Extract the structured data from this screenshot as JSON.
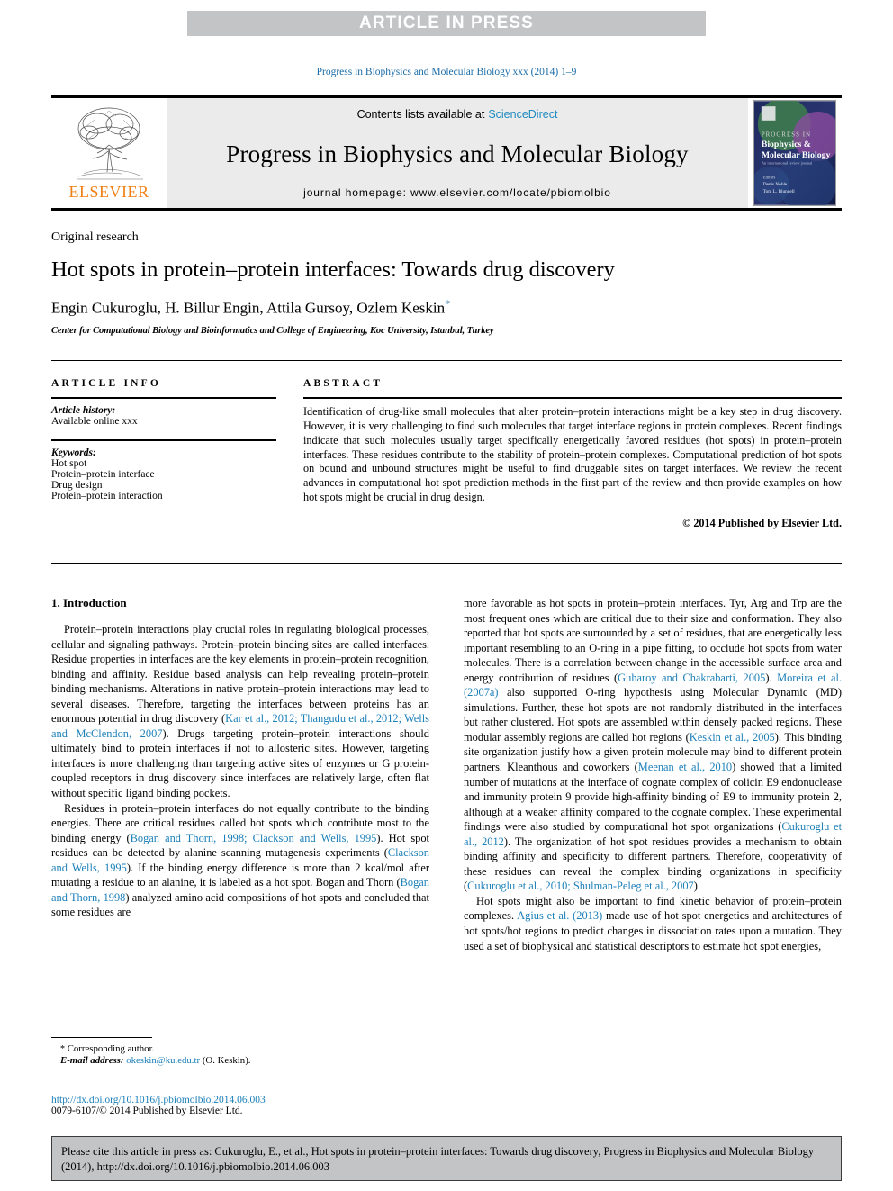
{
  "banner": {
    "label": "ARTICLE IN PRESS"
  },
  "running_head": "Progress in Biophysics and Molecular Biology xxx (2014) 1–9",
  "masthead": {
    "publisher": "ELSEVIER",
    "contents_prefix": "Contents lists available at",
    "contents_link": "ScienceDirect",
    "journal_title": "Progress in Biophysics and Molecular Biology",
    "homepage": "journal homepage: www.elsevier.com/locate/pbiomolbio",
    "cover": {
      "line1": "PROGRESS IN",
      "line2": "Biophysics &",
      "line3": "Molecular Biology",
      "line4": "Editors",
      "line5": "Denis Noble",
      "line6": "Tom L. Blundell"
    }
  },
  "title_block": {
    "kind": "Original research",
    "title": "Hot spots in protein–protein interfaces: Towards drug discovery",
    "authors": "Engin Cukuroglu, H. Billur Engin, Attila Gursoy, Ozlem Keskin",
    "corresponding_marker": "*",
    "affiliation": "Center for Computational Biology and Bioinformatics and College of Engineering, Koc University, Istanbul, Turkey"
  },
  "article_info": {
    "heading": "ARTICLE INFO",
    "history_label": "Article history:",
    "history_value": "Available online xxx",
    "keywords_label": "Keywords:",
    "keywords": [
      "Hot spot",
      "Protein–protein interface",
      "Drug design",
      "Protein–protein interaction"
    ]
  },
  "abstract": {
    "heading": "ABSTRACT",
    "text": "Identification of drug-like small molecules that alter protein–protein interactions might be a key step in drug discovery. However, it is very challenging to find such molecules that target interface regions in protein complexes. Recent findings indicate that such molecules usually target specifically energetically favored residues (hot spots) in protein–protein interfaces. These residues contribute to the stability of protein–protein complexes. Computational prediction of hot spots on bound and unbound structures might be useful to find druggable sites on target interfaces. We review the recent advances in computational hot spot prediction methods in the first part of the review and then provide examples on how hot spots might be crucial in drug design.",
    "copyright": "© 2014 Published by Elsevier Ltd."
  },
  "body": {
    "section_heading": "1. Introduction",
    "left_paragraphs": [
      {
        "parts": [
          {
            "t": "Protein–protein interactions play crucial roles in regulating biological processes, cellular and signaling pathways. Protein–protein binding sites are called interfaces. Residue properties in interfaces are the key elements in protein–protein recognition, binding and affinity. Residue based analysis can help revealing protein–protein binding mechanisms. Alterations in native protein–protein interactions may lead to several diseases. Therefore, targeting the interfaces between proteins has an enormous potential in drug discovery ("
          },
          {
            "t": "Kar et al., 2012; Thangudu et al., 2012; Wells and McClendon, 2007",
            "c": true
          },
          {
            "t": "). Drugs targeting protein–protein interactions should ultimately bind to protein interfaces if not to allosteric sites. However, targeting interfaces is more challenging than targeting active sites of enzymes or G protein-coupled receptors in drug discovery since interfaces are relatively large, often flat without specific ligand binding pockets."
          }
        ]
      },
      {
        "parts": [
          {
            "t": "Residues in protein–protein interfaces do not equally contribute to the binding energies. There are critical residues called hot spots which contribute most to the binding energy ("
          },
          {
            "t": "Bogan and Thorn, 1998; Clackson and Wells, 1995",
            "c": true
          },
          {
            "t": "). Hot spot residues can be detected by alanine scanning mutagenesis experiments ("
          },
          {
            "t": "Clackson and Wells, 1995",
            "c": true
          },
          {
            "t": "). If the binding energy difference is more than 2 kcal/mol after mutating a residue to an alanine, it is labeled as a hot spot. Bogan and Thorn ("
          },
          {
            "t": "Bogan and Thorn, 1998",
            "c": true
          },
          {
            "t": ") analyzed amino acid compositions of hot spots and concluded that some residues are"
          }
        ]
      }
    ],
    "right_paragraphs": [
      {
        "no_indent": true,
        "parts": [
          {
            "t": "more favorable as hot spots in protein–protein interfaces. Tyr, Arg and Trp are the most frequent ones which are critical due to their size and conformation. They also reported that hot spots are surrounded by a set of residues, that are energetically less important resembling to an O-ring in a pipe fitting, to occlude hot spots from water molecules. There is a correlation between change in the accessible surface area and energy contribution of residues ("
          },
          {
            "t": "Guharoy and Chakrabarti, 2005",
            "c": true
          },
          {
            "t": "). "
          },
          {
            "t": "Moreira et al. (2007a)",
            "c": true
          },
          {
            "t": " also supported O-ring hypothesis using Molecular Dynamic (MD) simulations. Further, these hot spots are not randomly distributed in the interfaces but rather clustered. Hot spots are assembled within densely packed regions. These modular assembly regions are called hot regions ("
          },
          {
            "t": "Keskin et al., 2005",
            "c": true
          },
          {
            "t": "). This binding site organization justify how a given protein molecule may bind to different protein partners. Kleanthous and coworkers ("
          },
          {
            "t": "Meenan et al., 2010",
            "c": true
          },
          {
            "t": ") showed that a limited number of mutations at the interface of cognate complex of colicin E9 endonuclease and immunity protein 9 provide high-affinity binding of E9 to immunity protein 2, although at a weaker affinity compared to the cognate complex. These experimental findings were also studied by computational hot spot organizations ("
          },
          {
            "t": "Cukuroglu et al., 2012",
            "c": true
          },
          {
            "t": "). The organization of hot spot residues provides a mechanism to obtain binding affinity and specificity to different partners. Therefore, cooperativity of these residues can reveal the complex binding organizations in specificity ("
          },
          {
            "t": "Cukuroglu et al., 2010; Shulman-Peleg et al., 2007",
            "c": true
          },
          {
            "t": ")."
          }
        ]
      },
      {
        "parts": [
          {
            "t": "Hot spots might also be important to find kinetic behavior of protein–protein complexes. "
          },
          {
            "t": "Agius et al. (2013)",
            "c": true
          },
          {
            "t": " made use of hot spot energetics and architectures of hot spots/hot regions to predict changes in dissociation rates upon a mutation. They used a set of biophysical and statistical descriptors to estimate hot spot energies,"
          }
        ]
      }
    ]
  },
  "footnote": {
    "star": "*",
    "corresponding": "Corresponding author.",
    "email_label": "E-mail address:",
    "email": "okeskin@ku.edu.tr",
    "email_suffix": "(O. Keskin)."
  },
  "doi_block": {
    "doi_url": "http://dx.doi.org/10.1016/j.pbiomolbio.2014.06.003",
    "issn_line": "0079-6107/© 2014 Published by Elsevier Ltd."
  },
  "cite_box": {
    "text": "Please cite this article in press as: Cukuroglu, E., et al., Hot spots in protein–protein interfaces: Towards drug discovery, Progress in Biophysics and Molecular Biology (2014), http://dx.doi.org/10.1016/j.pbiomolbio.2014.06.003"
  },
  "colors": {
    "link": "#1b7fb8",
    "banner_bg": "#c3c4c6",
    "elsevier_orange": "#f07f13"
  }
}
